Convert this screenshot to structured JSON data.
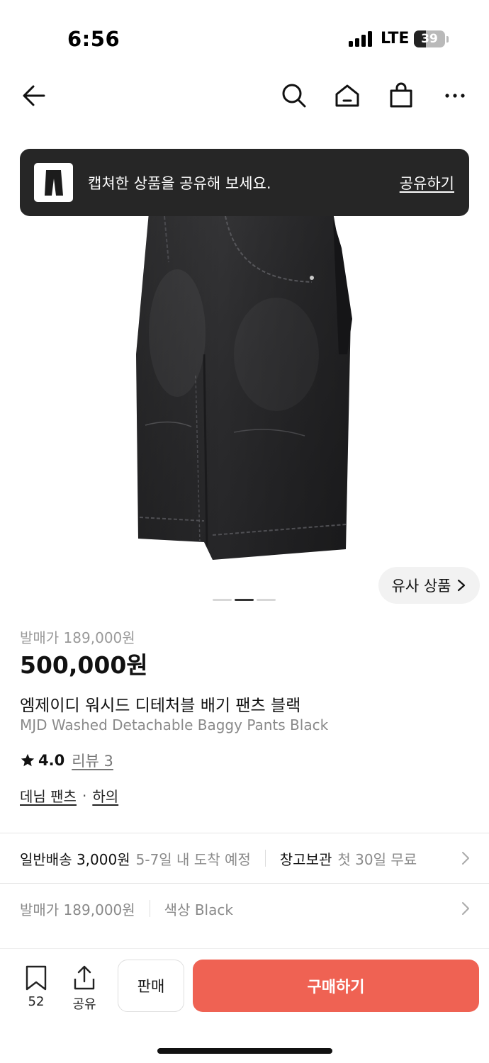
{
  "status": {
    "time": "6:56",
    "network": "LTE",
    "battery": "39",
    "battery_level": 0.39
  },
  "nav": {
    "icons": [
      "back-arrow-icon",
      "search-icon",
      "home-icon",
      "shopping-bag-icon",
      "more-icon"
    ]
  },
  "toast": {
    "message": "캡쳐한 상품을 공유해 보세요.",
    "action": "공유하기"
  },
  "gallery": {
    "similar_label": "유사 상품",
    "page_count": 3,
    "active_page": 2
  },
  "product": {
    "original_price": "발매가 189,000원",
    "price": "500,000원",
    "name_ko": "엠제이디 워시드 디테처블 배기 팬츠 블랙",
    "name_en": "MJD Washed Detachable Baggy Pants Black",
    "rating": "4.0",
    "review": "리뷰 3",
    "category": "데님 팬츠",
    "category_sep": "·",
    "subcategory": "하의"
  },
  "shipping": {
    "label": "일반배송 3,000원",
    "eta": "5-7일 내 도착 예정",
    "storage_label": "창고보관",
    "storage_note": "첫 30일 무료"
  },
  "options": {
    "original_price": "발매가 189,000원",
    "color": "색상 Black"
  },
  "bottom": {
    "bookmark_count": "52",
    "share_label": "공유",
    "sell_label": "판매",
    "buy_label": "구매하기"
  },
  "colors": {
    "buy_button": "#ef6253",
    "toast_bg": "#262626"
  }
}
